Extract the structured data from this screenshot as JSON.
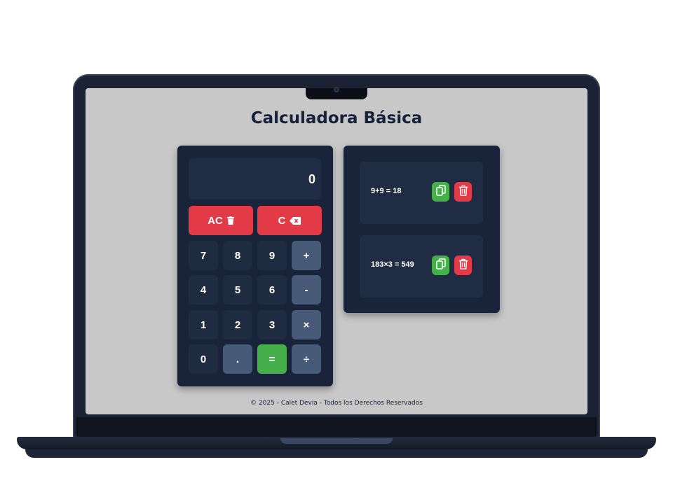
{
  "app": {
    "title": "Calculadora Básica",
    "footer": "© 2025 - Calet Devia - Todos los Derechos Reservados"
  },
  "calculator": {
    "display": "0",
    "clear_all_label": "AC",
    "clear_label": "C",
    "keys": {
      "k7": "7",
      "k8": "8",
      "k9": "9",
      "plus": "+",
      "k4": "4",
      "k5": "5",
      "k6": "6",
      "minus": "-",
      "k1": "1",
      "k2": "2",
      "k3": "3",
      "times": "×",
      "k0": "0",
      "dot": ".",
      "equals": "=",
      "divide": "÷"
    }
  },
  "history": {
    "items": [
      {
        "expression": "9+9 = 18"
      },
      {
        "expression": "183×3 = 549"
      }
    ]
  },
  "icons": {
    "trash": "trash-icon",
    "backspace": "backspace-icon",
    "copy": "copy-icon"
  },
  "colors": {
    "danger": "#e23b47",
    "success": "#45b049",
    "operator": "#475a77",
    "panel": "#19243a",
    "screen_bg": "#c8c8c8"
  }
}
